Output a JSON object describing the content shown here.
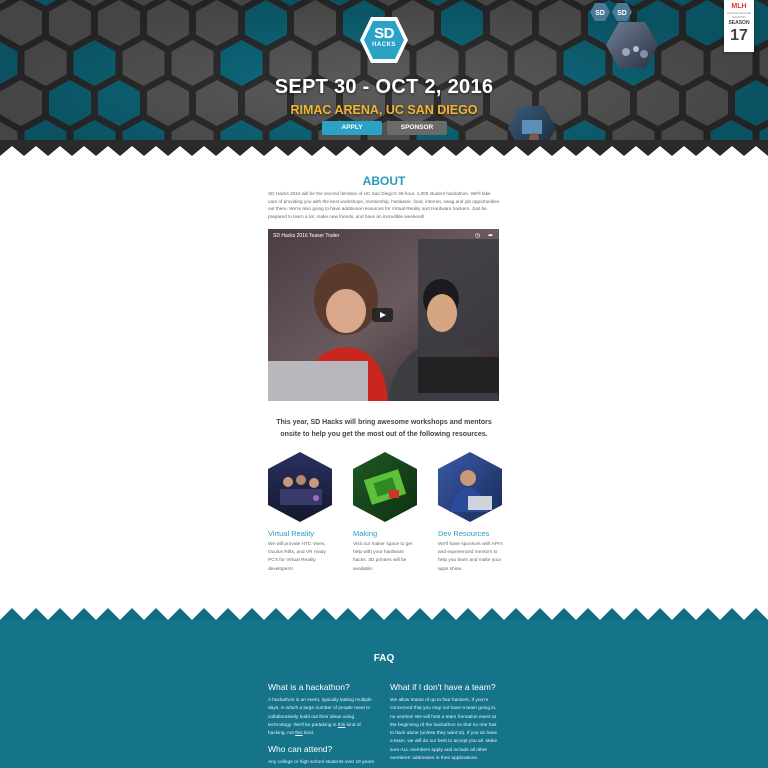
{
  "hero": {
    "logo_text": "SD",
    "logo_sub": "HACKS",
    "date": "SEPT 30 - OCT 2, 2016",
    "venue": "RIMAC ARENA, UC SAN DIEGO",
    "buttons": {
      "apply": "APPLY",
      "sponsor": "SPONSOR"
    },
    "colors": {
      "teal": "#0e6e82",
      "gray": "#5c5c5c",
      "accent": "#f2b632"
    }
  },
  "mlh": {
    "label": "MLH",
    "sub": "MAJOR LEAGUE HACKING",
    "season": "SEASON",
    "number": "17"
  },
  "about": {
    "title": "ABOUT",
    "body": "SD Hacks 2016 will be the second iteration of UC San Diego's 36-hour, 1,000 student hackathon. We'll take care of providing you with the best workshops, mentorship, hardware, food, internet, swag and job opportunities out there. We're also going to have additional resources for Virtual Reality and Hardware hackers.  Just be prepared to learn a lot, make new friends, and have an incredible weekend!",
    "video": {
      "title": "SD Hacks 2016 Teaser Trailer",
      "icons": [
        "clock-icon",
        "share-icon"
      ]
    }
  },
  "resources": {
    "intro": "This year, SD Hacks will bring awesome workshops and mentors onsite to help you get the most out of the following resources.",
    "items": [
      {
        "title": "Virtual Reality",
        "desc": "We will provide HTC Vives, Oculus Rifts, and VR ready PC's for Virtual Reality developers!"
      },
      {
        "title": "Making",
        "desc": "Visit our maker space to get help with your hardware hacks. 3D printers will be available."
      },
      {
        "title": "Dev Resources",
        "desc": "We'll have sponsors with API's and experienced mentors to help you learn and make your apps shine."
      }
    ]
  },
  "faq": {
    "title": "FAQ",
    "items": [
      {
        "q": "What is a hackathon?",
        "a_pre": "A hackathon is an event, typically lasting multiple days, in which a large number of people meet to collaboratively build out their ideas using technology. We'll be partaking in ",
        "a_u1": "this",
        "a_mid": " kind of hacking, not ",
        "a_u2": "this",
        "a_post": " kind."
      },
      {
        "q": "Who can attend?",
        "a": "Any college or high school students over 18 years"
      },
      {
        "q": "What if I don't have a team?",
        "a": "We allow teams of up to four hackers. If you're concerned that you may not have a team going in, no worries! We will host a team formation event at the beginning of the hackathon so that no one has to hack alone (unless they want to). If you do have a team, we will do our best to accept you all. Make sure ALL members apply and include all other members' addresses in their applications."
      }
    ]
  }
}
